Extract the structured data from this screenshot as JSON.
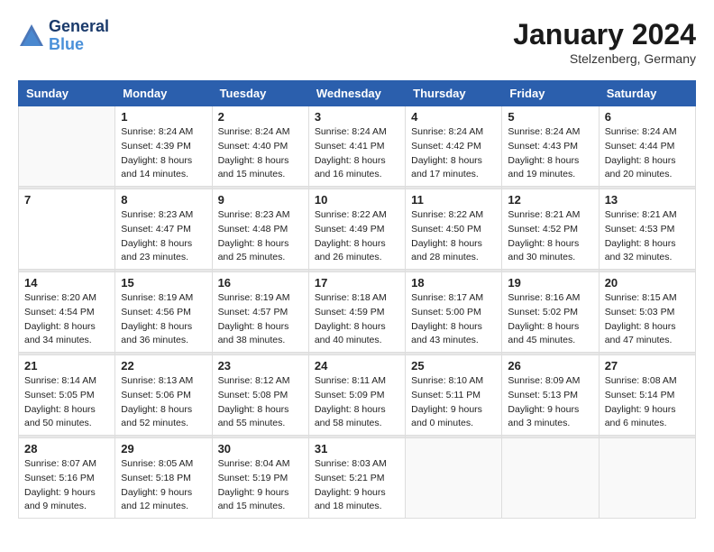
{
  "logo": {
    "line1": "General",
    "line2": "Blue"
  },
  "title": "January 2024",
  "location": "Stelzenberg, Germany",
  "weekdays": [
    "Sunday",
    "Monday",
    "Tuesday",
    "Wednesday",
    "Thursday",
    "Friday",
    "Saturday"
  ],
  "weeks": [
    [
      {
        "day": "",
        "info": ""
      },
      {
        "day": "1",
        "info": "Sunrise: 8:24 AM\nSunset: 4:39 PM\nDaylight: 8 hours\nand 14 minutes."
      },
      {
        "day": "2",
        "info": "Sunrise: 8:24 AM\nSunset: 4:40 PM\nDaylight: 8 hours\nand 15 minutes."
      },
      {
        "day": "3",
        "info": "Sunrise: 8:24 AM\nSunset: 4:41 PM\nDaylight: 8 hours\nand 16 minutes."
      },
      {
        "day": "4",
        "info": "Sunrise: 8:24 AM\nSunset: 4:42 PM\nDaylight: 8 hours\nand 17 minutes."
      },
      {
        "day": "5",
        "info": "Sunrise: 8:24 AM\nSunset: 4:43 PM\nDaylight: 8 hours\nand 19 minutes."
      },
      {
        "day": "6",
        "info": "Sunrise: 8:24 AM\nSunset: 4:44 PM\nDaylight: 8 hours\nand 20 minutes."
      }
    ],
    [
      {
        "day": "7",
        "info": ""
      },
      {
        "day": "8",
        "info": "Sunrise: 8:23 AM\nSunset: 4:47 PM\nDaylight: 8 hours\nand 23 minutes."
      },
      {
        "day": "9",
        "info": "Sunrise: 8:23 AM\nSunset: 4:48 PM\nDaylight: 8 hours\nand 25 minutes."
      },
      {
        "day": "10",
        "info": "Sunrise: 8:22 AM\nSunset: 4:49 PM\nDaylight: 8 hours\nand 26 minutes."
      },
      {
        "day": "11",
        "info": "Sunrise: 8:22 AM\nSunset: 4:50 PM\nDaylight: 8 hours\nand 28 minutes."
      },
      {
        "day": "12",
        "info": "Sunrise: 8:21 AM\nSunset: 4:52 PM\nDaylight: 8 hours\nand 30 minutes."
      },
      {
        "day": "13",
        "info": "Sunrise: 8:21 AM\nSunset: 4:53 PM\nDaylight: 8 hours\nand 32 minutes."
      }
    ],
    [
      {
        "day": "14",
        "info": "Sunrise: 8:20 AM\nSunset: 4:54 PM\nDaylight: 8 hours\nand 34 minutes."
      },
      {
        "day": "15",
        "info": "Sunrise: 8:19 AM\nSunset: 4:56 PM\nDaylight: 8 hours\nand 36 minutes."
      },
      {
        "day": "16",
        "info": "Sunrise: 8:19 AM\nSunset: 4:57 PM\nDaylight: 8 hours\nand 38 minutes."
      },
      {
        "day": "17",
        "info": "Sunrise: 8:18 AM\nSunset: 4:59 PM\nDaylight: 8 hours\nand 40 minutes."
      },
      {
        "day": "18",
        "info": "Sunrise: 8:17 AM\nSunset: 5:00 PM\nDaylight: 8 hours\nand 43 minutes."
      },
      {
        "day": "19",
        "info": "Sunrise: 8:16 AM\nSunset: 5:02 PM\nDaylight: 8 hours\nand 45 minutes."
      },
      {
        "day": "20",
        "info": "Sunrise: 8:15 AM\nSunset: 5:03 PM\nDaylight: 8 hours\nand 47 minutes."
      }
    ],
    [
      {
        "day": "21",
        "info": "Sunrise: 8:14 AM\nSunset: 5:05 PM\nDaylight: 8 hours\nand 50 minutes."
      },
      {
        "day": "22",
        "info": "Sunrise: 8:13 AM\nSunset: 5:06 PM\nDaylight: 8 hours\nand 52 minutes."
      },
      {
        "day": "23",
        "info": "Sunrise: 8:12 AM\nSunset: 5:08 PM\nDaylight: 8 hours\nand 55 minutes."
      },
      {
        "day": "24",
        "info": "Sunrise: 8:11 AM\nSunset: 5:09 PM\nDaylight: 8 hours\nand 58 minutes."
      },
      {
        "day": "25",
        "info": "Sunrise: 8:10 AM\nSunset: 5:11 PM\nDaylight: 9 hours\nand 0 minutes."
      },
      {
        "day": "26",
        "info": "Sunrise: 8:09 AM\nSunset: 5:13 PM\nDaylight: 9 hours\nand 3 minutes."
      },
      {
        "day": "27",
        "info": "Sunrise: 8:08 AM\nSunset: 5:14 PM\nDaylight: 9 hours\nand 6 minutes."
      }
    ],
    [
      {
        "day": "28",
        "info": "Sunrise: 8:07 AM\nSunset: 5:16 PM\nDaylight: 9 hours\nand 9 minutes."
      },
      {
        "day": "29",
        "info": "Sunrise: 8:05 AM\nSunset: 5:18 PM\nDaylight: 9 hours\nand 12 minutes."
      },
      {
        "day": "30",
        "info": "Sunrise: 8:04 AM\nSunset: 5:19 PM\nDaylight: 9 hours\nand 15 minutes."
      },
      {
        "day": "31",
        "info": "Sunrise: 8:03 AM\nSunset: 5:21 PM\nDaylight: 9 hours\nand 18 minutes."
      },
      {
        "day": "",
        "info": ""
      },
      {
        "day": "",
        "info": ""
      },
      {
        "day": "",
        "info": ""
      }
    ]
  ]
}
